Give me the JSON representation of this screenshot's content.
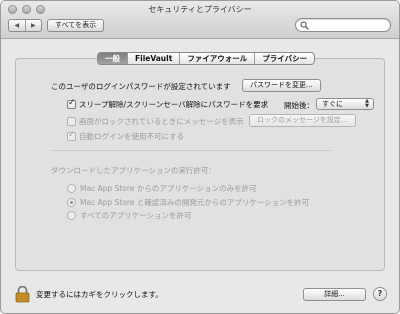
{
  "window": {
    "title": "セキュリティとプライバシー"
  },
  "toolbar": {
    "back_label": "◀",
    "forward_label": "▶",
    "show_all_label": "すべてを表示",
    "search": {
      "placeholder": "",
      "value": ""
    }
  },
  "tabs": [
    {
      "label": "一般",
      "active": true
    },
    {
      "label": "FileVault",
      "active": false
    },
    {
      "label": "ファイアウォール",
      "active": false
    },
    {
      "label": "プライバシー",
      "active": false
    }
  ],
  "general": {
    "password_set_text": "このユーザのログインパスワードが設定されています",
    "change_password_button": "パスワードを変更...",
    "require_password": {
      "label": "スリープ解除/スクリーンセーバ解除にパスワードを要求",
      "checked": true
    },
    "after_label": "開始後：",
    "after_value": "すぐに",
    "show_message": {
      "label": "画面がロックされているときにメッセージを表示",
      "checked": false,
      "enabled": false
    },
    "lock_message_button": "ロックのメッセージを設定...",
    "disable_autologin": {
      "label": "自動ログインを使用不可にする",
      "checked": true,
      "enabled": false
    },
    "downloads_heading": "ダウンロードしたアプリケーションの実行許可：",
    "download_options": [
      {
        "label": "Mac App Store からのアプリケーションのみを許可",
        "selected": false
      },
      {
        "label": "Mac App Store と確認済みの開発元からのアプリケーションを許可",
        "selected": true
      },
      {
        "label": "すべてのアプリケーションを許可",
        "selected": false
      }
    ]
  },
  "footer": {
    "lock_text": "変更するにはカギをクリックします。",
    "advanced_button": "詳細...",
    "help_label": "?"
  },
  "icons": {
    "lock": "lock-icon",
    "search": "search-icon"
  }
}
